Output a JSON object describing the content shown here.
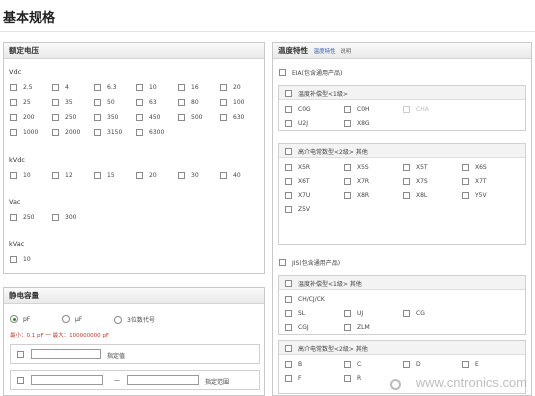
{
  "page": {
    "title": "基本规格"
  },
  "voltage": {
    "header": "额定电压",
    "groups": [
      {
        "label": "Vdc",
        "items": [
          "2.5",
          "4",
          "6.3",
          "10",
          "16",
          "20",
          "25",
          "35",
          "50",
          "63",
          "80",
          "100",
          "200",
          "250",
          "350",
          "450",
          "500",
          "630",
          "1000",
          "2000",
          "3150",
          "6300"
        ]
      },
      {
        "label": "kVdc",
        "items": [
          "10",
          "12",
          "15",
          "20",
          "30",
          "40"
        ]
      },
      {
        "label": "Vac",
        "items": [
          "250",
          "300"
        ]
      },
      {
        "label": "kVac",
        "items": [
          "10"
        ]
      }
    ]
  },
  "capacitance": {
    "header": "静电容量",
    "units": [
      "pF",
      "μF",
      "3位数代号"
    ],
    "selected_unit": "pF",
    "range_text": "最小：0.1 pF 一  最大：100000000 pF",
    "specify_label": "指定值",
    "range_label": "指定范围",
    "range_dash": "一"
  },
  "temp": {
    "header": "温度特性",
    "link": "温度特性",
    "link_suffix": "说明",
    "eia_label": "EIA(包含通用产品)",
    "eia_class1_title": "温度补偿型<1级>",
    "eia_class1": [
      "C0G",
      "C0H",
      "CHA",
      "U2J",
      "X8G"
    ],
    "eia_class2_title": "高介电常数型<2级> 其他",
    "eia_class2": [
      "X5R",
      "X5S",
      "X5T",
      "X6S",
      "X6T",
      "X7R",
      "X7S",
      "X7T",
      "X7U",
      "X8R",
      "X8L",
      "Y5V",
      "Z5V"
    ],
    "jis_label": "JIS(包含通用产品)",
    "jis_class1_title": "温度补偿型<1级> 其他",
    "jis_class1": [
      "CH/CJ/CK",
      "SL",
      "UJ",
      "CG",
      "CGJ",
      "ZLM"
    ],
    "jis_class2_title": "高介电常数型<2级> 其他",
    "jis_class2": [
      "B",
      "C",
      "D",
      "E",
      "F",
      "R"
    ]
  },
  "watermark": "www.cntronics.com"
}
